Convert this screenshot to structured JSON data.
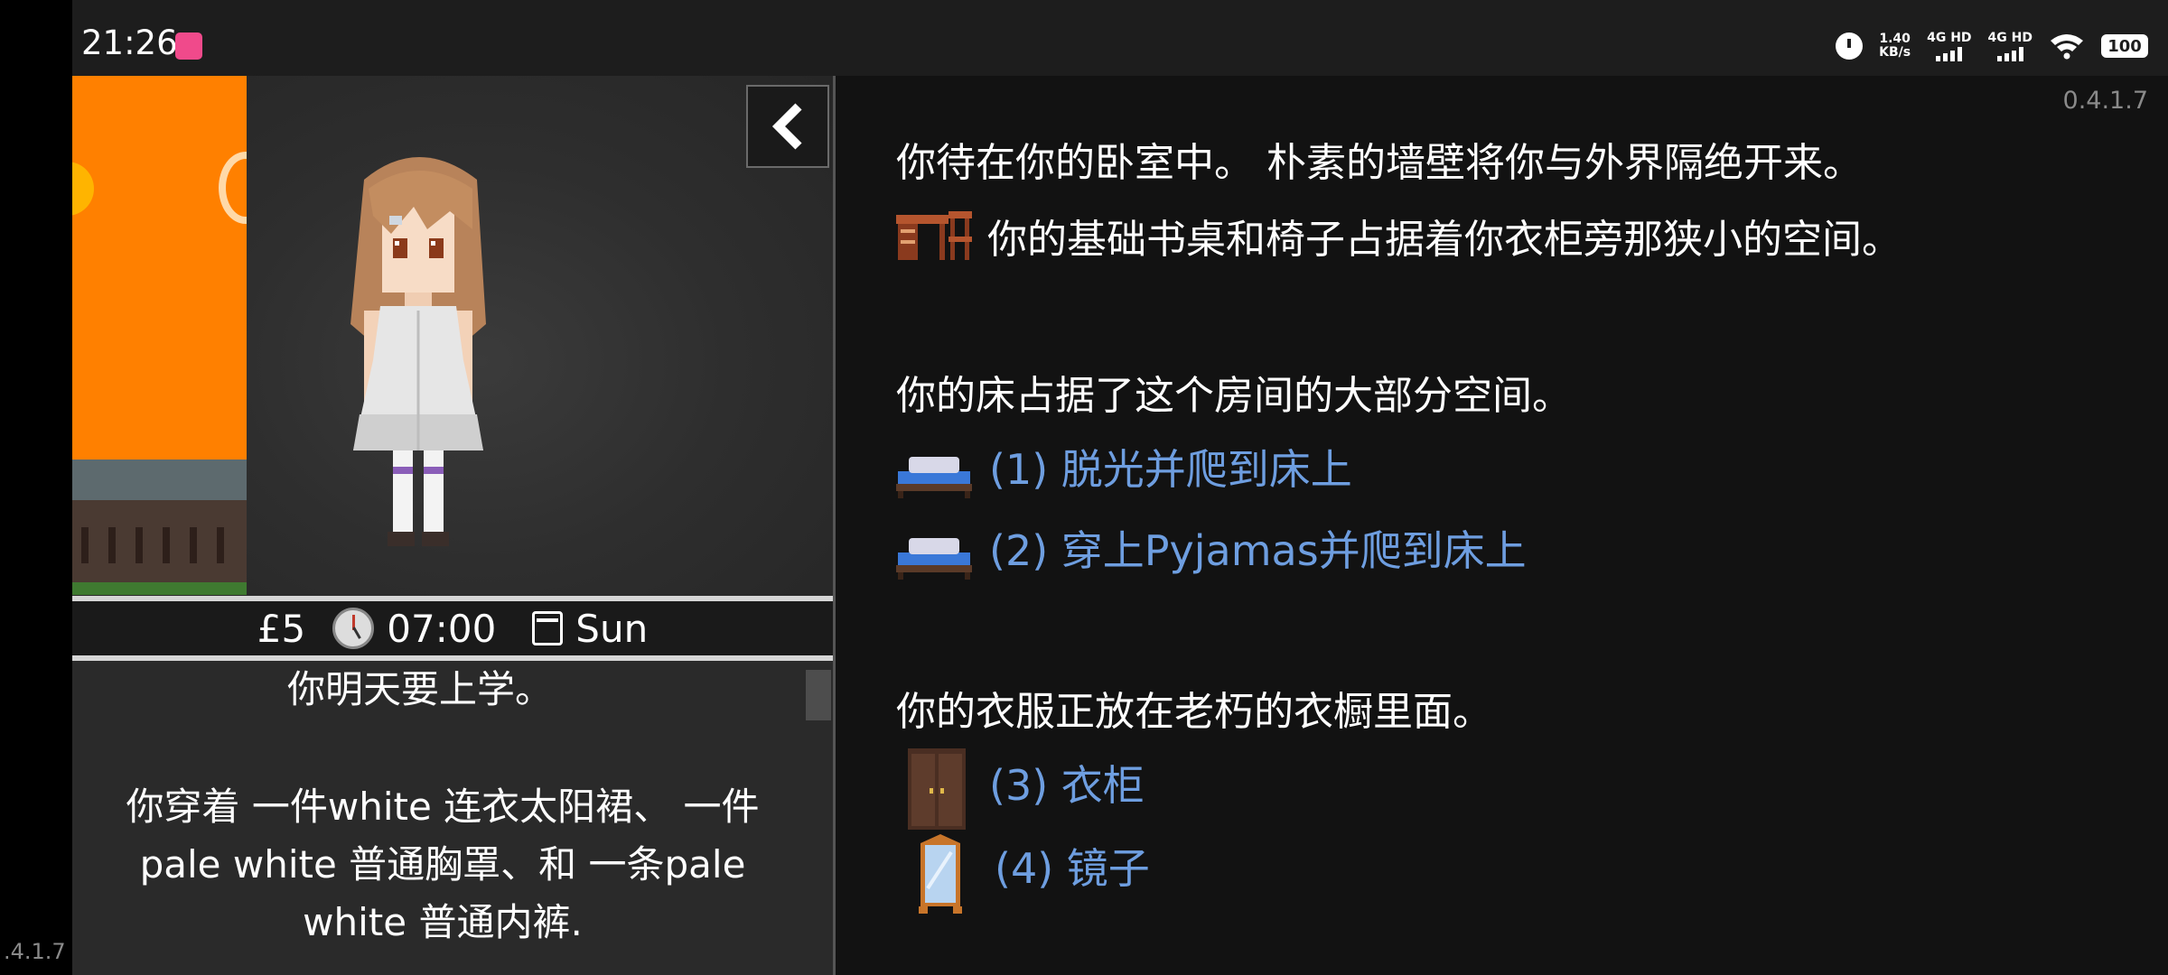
{
  "status_bar": {
    "time": "21:26",
    "speed_value": "1.40",
    "speed_unit": "KB/s",
    "network1": "4G HD",
    "network2": "4G HD",
    "battery": "100"
  },
  "scene": {
    "money": "£5",
    "time": "07:00",
    "day": "Sun"
  },
  "description": {
    "line1": "你明天要上学。",
    "line2": "你穿着 一件white 连衣太阳裙、 一件pale white 普通胸罩、和 一条pale white 普通内裤."
  },
  "version": ".4.1.7",
  "version_right": "0.4.1.7",
  "room": {
    "intro": "你待在你的卧室中。 朴素的墙壁将你与外界隔绝开来。",
    "desk": "你的基础书桌和椅子占据着你衣柜旁那狭小的空间。",
    "bed": "你的床占据了这个房间的大部分空间。",
    "actions": [
      {
        "label": "(1) 脱光并爬到床上",
        "icon": "bed-icon"
      },
      {
        "label": "(2) 穿上Pyjamas并爬到床上",
        "icon": "bed-icon"
      }
    ],
    "clothes": "你的衣服正放在老朽的衣橱里面。",
    "options": [
      {
        "label": "(3) 衣柜",
        "icon": "wardrobe-icon"
      },
      {
        "label": "(4) 镜子",
        "icon": "mirror-icon"
      }
    ]
  },
  "colors": {
    "link": "#6e9ee0",
    "sky": "#ff8000",
    "panel_bg": "#121212"
  }
}
